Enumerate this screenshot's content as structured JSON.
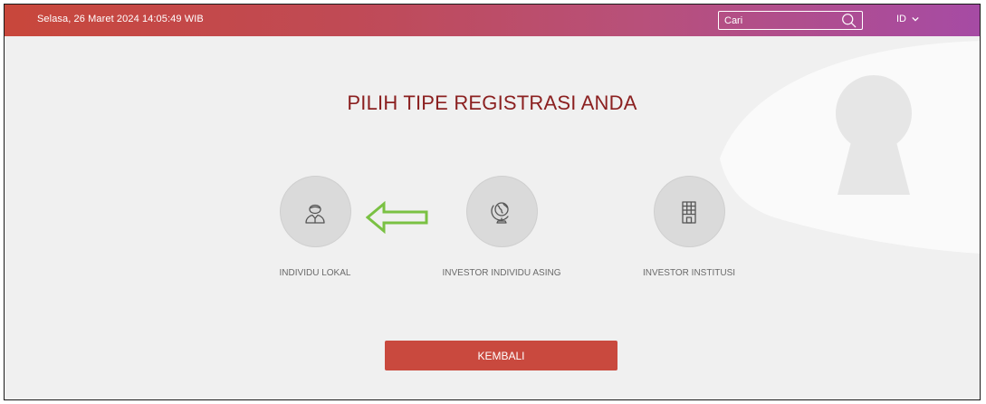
{
  "header": {
    "datetime": "Selasa, 26 Maret 2024 14:05:49 WIB",
    "search": {
      "placeholder": "Cari",
      "value": "",
      "icon": "search-icon"
    },
    "language": {
      "label": "ID",
      "icon": "chevron-down-icon"
    }
  },
  "main": {
    "title": "PILIH TIPE REGISTRASI ANDA",
    "options": [
      {
        "label": "INDIVIDU LOKAL",
        "icon": "person-icon"
      },
      {
        "label": "INVESTOR INDIVIDU ASING",
        "icon": "globe-icon"
      },
      {
        "label": "INVESTOR INSTITUSI",
        "icon": "building-icon"
      }
    ],
    "back_label": "KEMBALI"
  },
  "colors": {
    "header_gradient_start": "#c8473b",
    "header_gradient_end": "#a64ba4",
    "title": "#8b2020",
    "button": "#c9493e",
    "annotation_arrow": "#7ac143",
    "background": "#f0f0f0"
  }
}
